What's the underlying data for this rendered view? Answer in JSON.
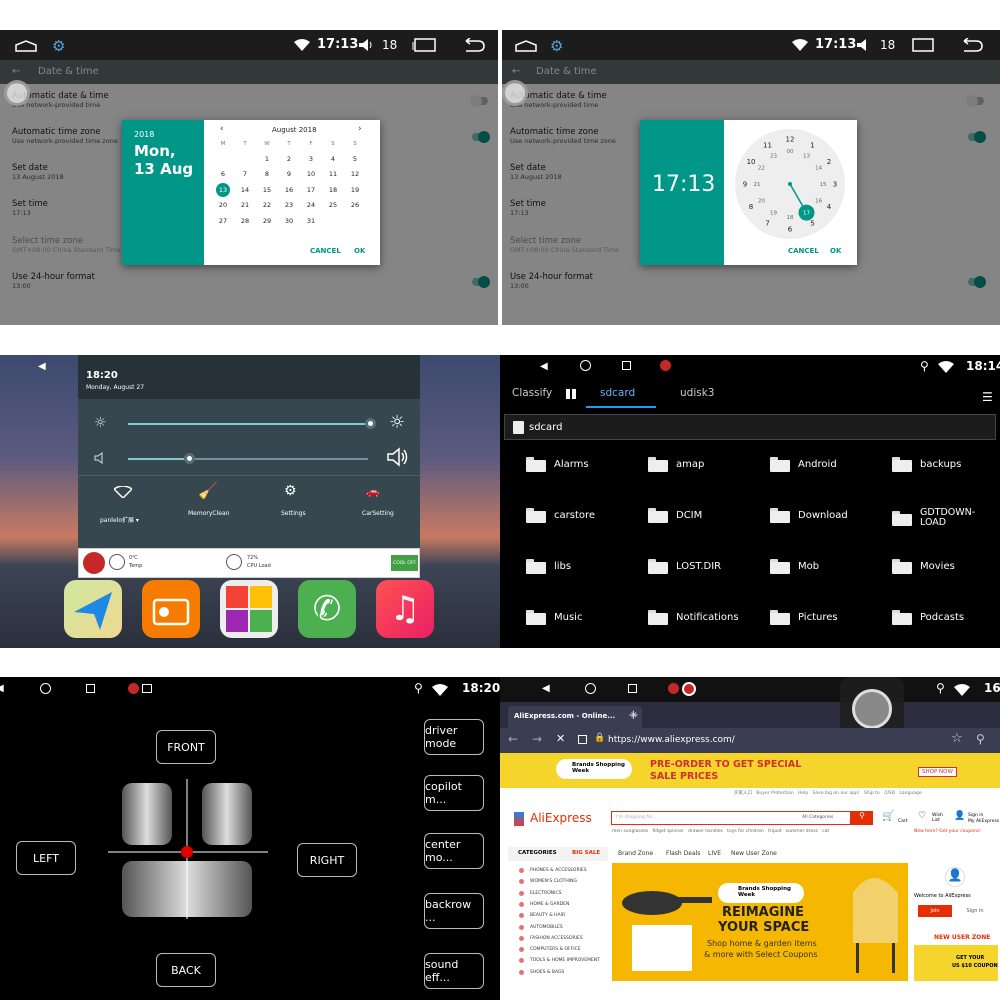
{
  "status_bar": {
    "time_a": "17:13",
    "volume_level": "18",
    "time_c": "18:14",
    "time_d": "18:20",
    "time_e_partial": "16:"
  },
  "date_time": {
    "header": "Date & time",
    "rows": [
      {
        "title": "Automatic date & time",
        "sub": "Use network-provided time"
      },
      {
        "title": "Automatic time zone",
        "sub": "Use network-provided time zone"
      },
      {
        "title": "Set date",
        "sub": "13 August 2018"
      },
      {
        "title": "Set time",
        "sub": "17:13"
      },
      {
        "title": "Select time zone",
        "sub": "GMT+08:00 China Standard Time"
      },
      {
        "title": "Use 24-hour format",
        "sub": "13:00"
      }
    ],
    "date_dialog": {
      "year": "2018",
      "day_line1": "Mon,",
      "day_line2": "13 Aug",
      "month": "August 2018",
      "weekdays": [
        "M",
        "T",
        "W",
        "T",
        "F",
        "S",
        "S"
      ],
      "weeks": [
        [
          "",
          "",
          "1",
          "2",
          "3",
          "4",
          "5"
        ],
        [
          "6",
          "7",
          "8",
          "9",
          "10",
          "11",
          "12"
        ],
        [
          "13",
          "14",
          "15",
          "16",
          "17",
          "18",
          "19"
        ],
        [
          "20",
          "21",
          "22",
          "23",
          "24",
          "25",
          "26"
        ],
        [
          "27",
          "28",
          "29",
          "30",
          "31",
          "",
          ""
        ]
      ],
      "selected": "13",
      "cancel": "CANCEL",
      "ok": "OK"
    },
    "time_dialog": {
      "time": "17:13",
      "outer": [
        "12",
        "1",
        "2",
        "3",
        "4",
        "5",
        "6",
        "7",
        "8",
        "9",
        "10",
        "11"
      ],
      "inner": [
        "00",
        "13",
        "14",
        "15",
        "16",
        "17",
        "18",
        "19",
        "20",
        "21",
        "22",
        "23"
      ],
      "selected": "17",
      "cancel": "CANCEL",
      "ok": "OK"
    }
  },
  "notification": {
    "time": "18:20",
    "date": "Monday, August 27",
    "network_label": "panlelo扩展 ▾",
    "tiles": [
      "MemoryClean",
      "Settings",
      "CarSetting"
    ],
    "temp_value": "0℃",
    "temp_label": "Temp",
    "cpu_value": "72%",
    "cpu_label": "CPU Load",
    "cool_button": "COOL OFF"
  },
  "file_manager": {
    "tabs": [
      "Classify",
      "sdcard",
      "udisk3"
    ],
    "path": "sdcard",
    "folders": [
      "Alarms",
      "amap",
      "Android",
      "backups",
      "carstore",
      "DCIM",
      "Download",
      "GDTDOWN-LOAD",
      "libs",
      "LOST.DIR",
      "Mob",
      "Movies",
      "Music",
      "Notifications",
      "Pictures",
      "Podcasts"
    ]
  },
  "seat": {
    "front": "FRONT",
    "back": "BACK",
    "left": "LEFT",
    "right": "RIGHT",
    "modes": [
      "driver mode",
      "copilot m...",
      "center mo...",
      "backrow ...",
      "sound eff..."
    ]
  },
  "browser": {
    "tab_title": "AliExpress.com - Online...",
    "url": "https://www.aliexpress.com/",
    "promo_badge": "Brands Shopping Week",
    "promo_line1": "PRE-ORDER TO GET SPECIAL",
    "promo_line2": "SALE PRICES",
    "shop_now": "SHOP NOW",
    "logo": "AliExpress",
    "search_placeholder": "I'm shopping for...",
    "all_categories": "All Categories",
    "suggestions": "men sunglasses   fidget spinner   drawer handles   toys for children   tripod   summer dress   cat",
    "top_links": "买家入口   Buyer Protection   Help   Save big on our app!   Ship to   /USD   Language",
    "categories_label": "CATEGORIES",
    "big_sale": "BIG SALE",
    "nav": [
      "Brand Zone",
      "Flash Deals",
      "LIVE",
      "New User Zone"
    ],
    "categories": [
      "PHONES & ACCESSORIES",
      "WOMEN'S CLOTHING",
      "ELECTRONICS",
      "HOME & GARDEN",
      "BEAUTY & HAIR",
      "AUTOMOBILES",
      "FASHION ACCESSORIES",
      "COMPUTERS & OFFICE",
      "TOOLS & HOME IMPROVEMENT",
      "SHOES & BAGS"
    ],
    "hero_badge": "Brands Shopping Week",
    "hero_title1": "REIMAGINE",
    "hero_title2": "YOUR SPACE",
    "hero_sub1": "Shop home & garden items",
    "hero_sub2": "& more with Select Coupons",
    "cart": "Cart",
    "wish": "Wish List",
    "signin": "Sign in",
    "myaccount": "My AliExpress",
    "new_here": "New here? Get your coupons!",
    "welcome": "Welcome to AliExpress",
    "join": "Join",
    "sign_in_btn": "Sign in",
    "new_user_zone": "NEW USER ZONE",
    "coupon1": "GET YOUR",
    "coupon2": "US $10 COUPON"
  },
  "colors": {
    "teal": "#009688",
    "ali_red": "#e62e04",
    "promo_yellow": "#f5d42c"
  }
}
